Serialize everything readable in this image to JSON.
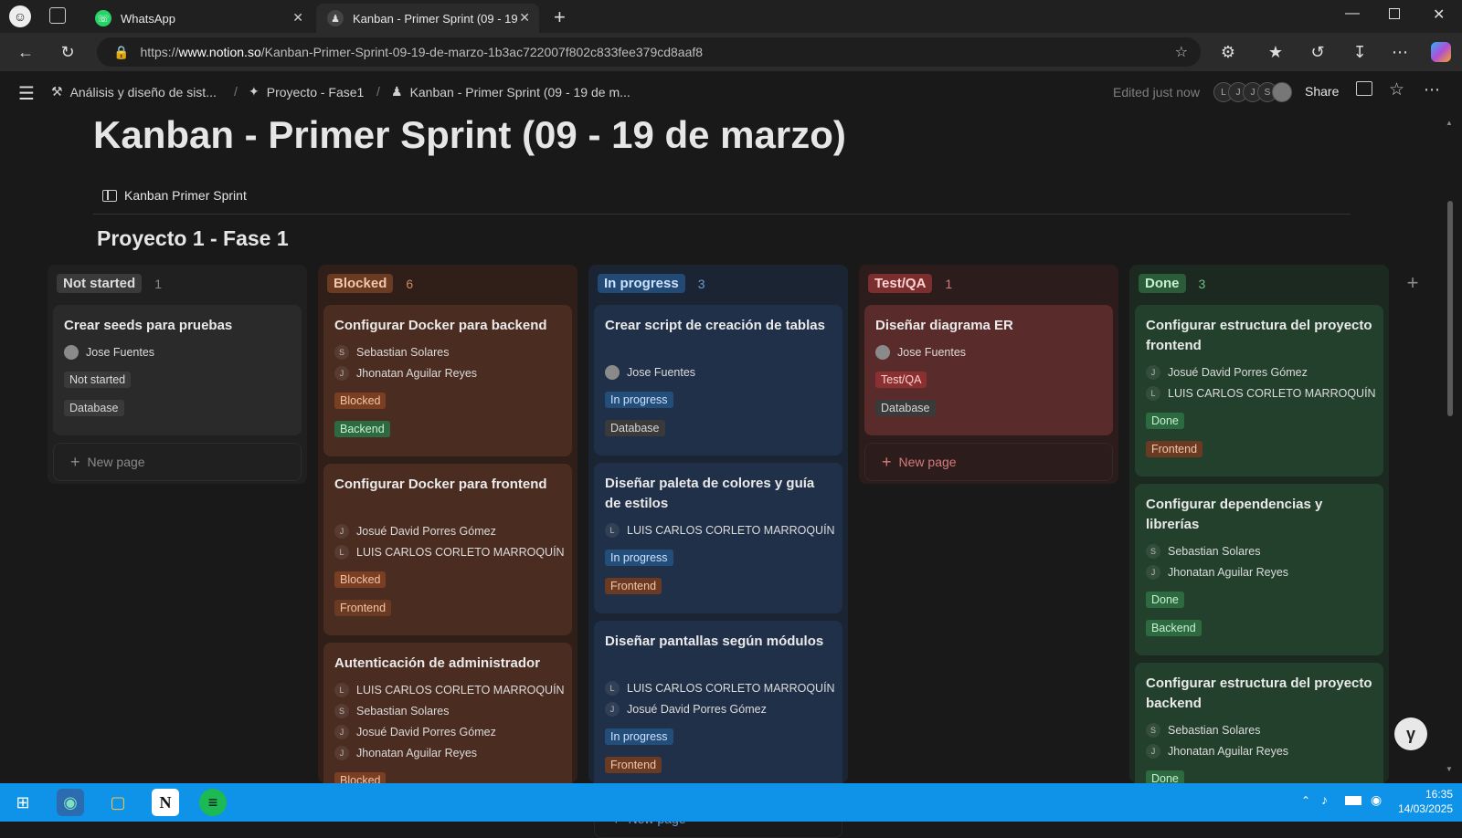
{
  "browser": {
    "tabs": [
      {
        "title": "WhatsApp",
        "icon": "whatsapp-icon"
      },
      {
        "title": "Kanban - Primer Sprint (09 - 19 d",
        "icon": "notion-page-icon"
      }
    ],
    "url_prefix": "https://",
    "url_domain": "www.notion.so",
    "url_path": "/Kanban-Primer-Sprint-09-19-de-marzo-1b3ac722007f802c833fee379cd8aaf8"
  },
  "topbar": {
    "breadcrumbs": [
      "Análisis y diseño de sist...",
      "Proyecto - Fase1",
      "Kanban - Primer Sprint (09 - 19 de m..."
    ],
    "edited": "Edited just now",
    "avatars": [
      "L",
      "J",
      "J",
      "S"
    ],
    "share": "Share"
  },
  "page": {
    "title": "Kanban - Primer Sprint (09 - 19 de marzo)",
    "view_name": "Kanban Primer Sprint",
    "db_title": "Proyecto 1 - Fase 1",
    "new_page": "New page"
  },
  "colors": {
    "not_started_bg": "#202020",
    "blocked_bg": "#2f1f18",
    "inprogress_bg": "#1a2433",
    "testqa_bg": "#2c1c1c",
    "done_bg": "#1c2920"
  },
  "board": {
    "columns": [
      {
        "label": "Not started",
        "count": "1",
        "cards": [
          {
            "title": "Crear seeds para pruebas",
            "people": [
              {
                "initial": "",
                "name": "Jose Fuentes"
              }
            ],
            "status": "Not started",
            "tag": "Database"
          }
        ]
      },
      {
        "label": "Blocked",
        "count": "6",
        "cards": [
          {
            "title": "Configurar Docker para backend",
            "people": [
              {
                "initial": "S",
                "name": "Sebastian Solares"
              },
              {
                "initial": "J",
                "name": "Jhonatan Aguilar Reyes"
              }
            ],
            "status": "Blocked",
            "tag": "Backend"
          },
          {
            "title": "Configurar Docker para frontend",
            "people": [
              {
                "initial": "J",
                "name": "Josué David Porres Gómez"
              },
              {
                "initial": "L",
                "name": "LUIS CARLOS CORLETO MARROQUÍN"
              }
            ],
            "status": "Blocked",
            "tag": "Frontend"
          },
          {
            "title": "Autenticación de administrador",
            "people": [
              {
                "initial": "L",
                "name": "LUIS CARLOS CORLETO MARROQUÍN"
              },
              {
                "initial": "S",
                "name": "Sebastian Solares"
              },
              {
                "initial": "J",
                "name": "Josué David Porres Gómez"
              },
              {
                "initial": "J",
                "name": "Jhonatan Aguilar Reyes"
              }
            ],
            "status": "Blocked",
            "tag": ""
          }
        ]
      },
      {
        "label": "In progress",
        "count": "3",
        "cards": [
          {
            "title": "Crear script de creación de tablas",
            "people": [
              {
                "initial": "",
                "name": "Jose Fuentes"
              }
            ],
            "status": "In progress",
            "tag": "Database"
          },
          {
            "title": "Diseñar paleta de colores y guía de estilos",
            "people": [
              {
                "initial": "L",
                "name": "LUIS CARLOS CORLETO MARROQUÍN"
              }
            ],
            "status": "In progress",
            "tag": "Frontend"
          },
          {
            "title": "Diseñar pantallas según módulos",
            "people": [
              {
                "initial": "L",
                "name": "LUIS CARLOS CORLETO MARROQUÍN"
              },
              {
                "initial": "J",
                "name": "Josué David Porres Gómez"
              }
            ],
            "status": "In progress",
            "tag": "Frontend"
          }
        ]
      },
      {
        "label": "Test/QA",
        "count": "1",
        "cards": [
          {
            "title": "Diseñar diagrama ER",
            "people": [
              {
                "initial": "",
                "name": "Jose Fuentes"
              }
            ],
            "status": "Test/QA",
            "tag": "Database"
          }
        ]
      },
      {
        "label": "Done",
        "count": "3",
        "cards": [
          {
            "title": "Configurar estructura del proyecto frontend",
            "people": [
              {
                "initial": "J",
                "name": "Josué David Porres Gómez"
              },
              {
                "initial": "L",
                "name": "LUIS CARLOS CORLETO MARROQUÍN"
              }
            ],
            "status": "Done",
            "tag": "Frontend"
          },
          {
            "title": "Configurar dependencias y librerías",
            "people": [
              {
                "initial": "S",
                "name": "Sebastian Solares"
              },
              {
                "initial": "J",
                "name": "Jhonatan Aguilar Reyes"
              }
            ],
            "status": "Done",
            "tag": "Backend"
          },
          {
            "title": "Configurar estructura del proyecto backend",
            "people": [
              {
                "initial": "S",
                "name": "Sebastian Solares"
              },
              {
                "initial": "J",
                "name": "Jhonatan Aguilar Reyes"
              }
            ],
            "status": "Done",
            "tag": ""
          }
        ]
      }
    ]
  },
  "taskbar": {
    "time": "16:35",
    "date": "14/03/2025"
  }
}
